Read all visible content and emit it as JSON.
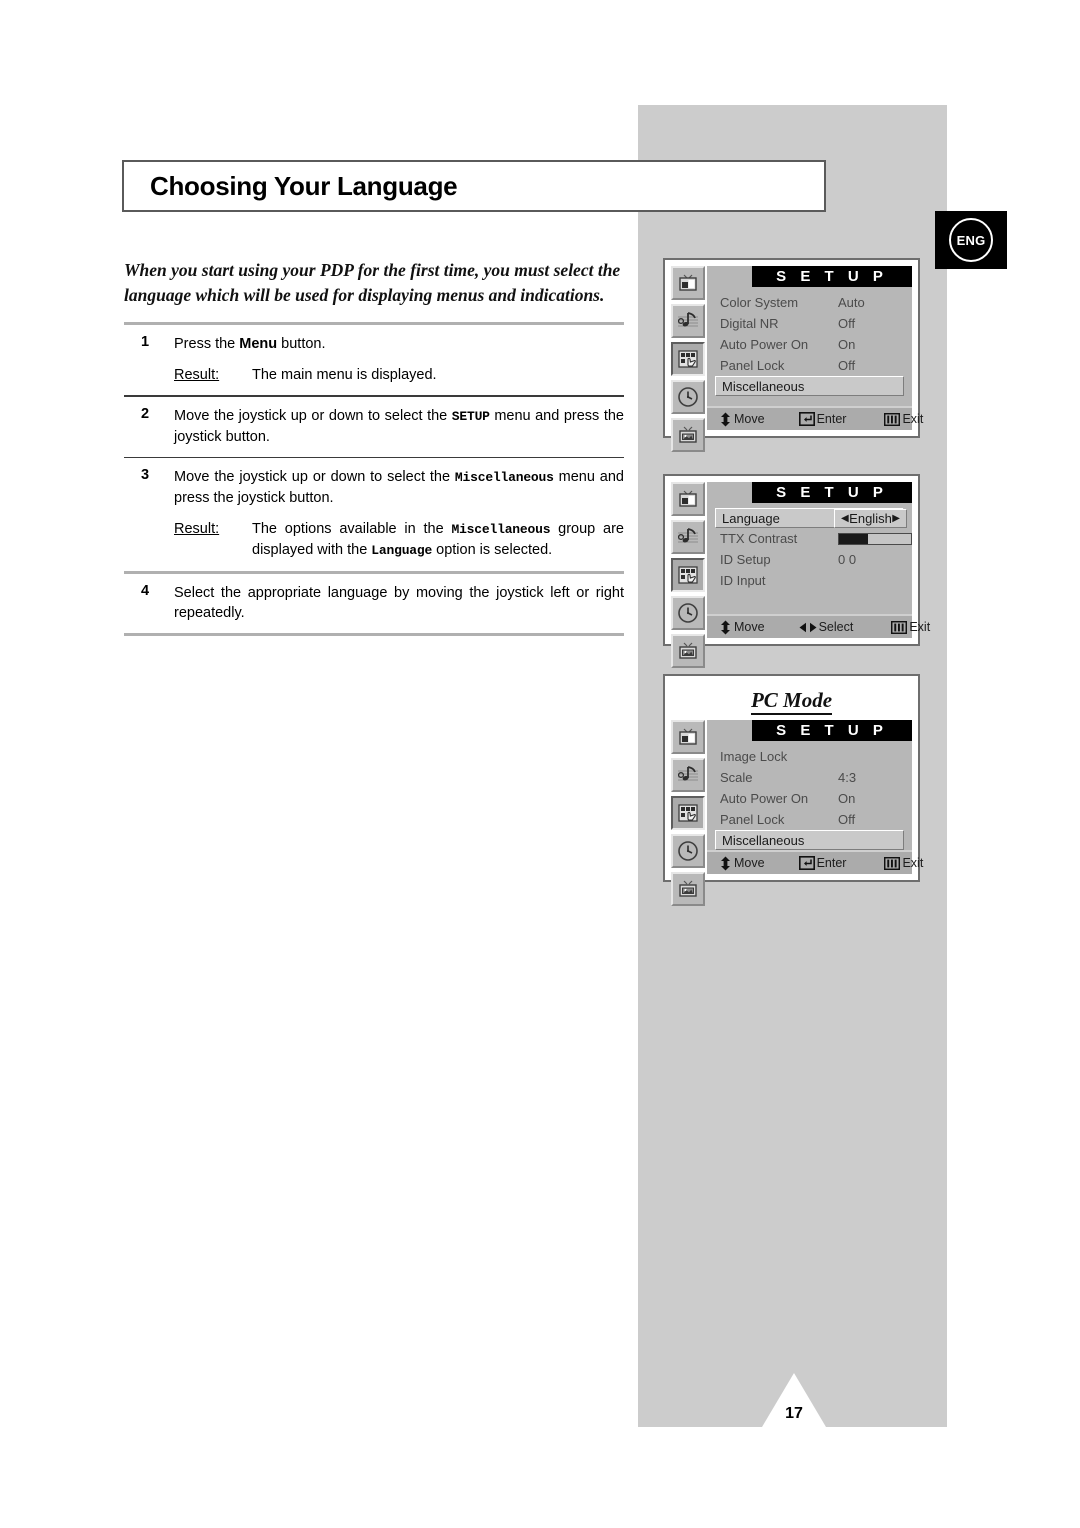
{
  "document": {
    "title": "Choosing Your Language",
    "language_badge": "ENG",
    "page_number": "17",
    "intro": "When you start using your PDP for the first time, you must select the language which will be used for displaying menus and indications."
  },
  "steps": [
    {
      "number": "1",
      "text_parts": [
        {
          "t": "Press the ",
          "style": "normal"
        },
        {
          "t": "Menu",
          "style": "bold"
        },
        {
          "t": " button.",
          "style": "normal"
        }
      ],
      "result_label": "Result:",
      "result_parts": [
        {
          "t": "The main menu is displayed.",
          "style": "normal"
        }
      ]
    },
    {
      "number": "2",
      "text_parts": [
        {
          "t": "Move the joystick up or down to select the ",
          "style": "normal"
        },
        {
          "t": "SETUP",
          "style": "mono"
        },
        {
          "t": " menu and press the joystick button.",
          "style": "normal"
        }
      ],
      "result_label": "",
      "result_parts": []
    },
    {
      "number": "3",
      "text_parts": [
        {
          "t": "Move the joystick up or down to select the ",
          "style": "normal"
        },
        {
          "t": "Miscellaneous",
          "style": "mono"
        },
        {
          "t": " menu and press the joystick button.",
          "style": "normal"
        }
      ],
      "result_label": "Result:",
      "result_parts": [
        {
          "t": "The options available in the ",
          "style": "normal"
        },
        {
          "t": "Miscellaneous",
          "style": "mono"
        },
        {
          "t": " group are displayed with the ",
          "style": "normal"
        },
        {
          "t": "Language",
          "style": "mono"
        },
        {
          "t": " option is selected.",
          "style": "normal"
        }
      ]
    },
    {
      "number": "4",
      "text_parts": [
        {
          "t": "Select the appropriate language by moving the joystick left or right repeatedly.",
          "style": "normal"
        }
      ],
      "result_label": "",
      "result_parts": []
    }
  ],
  "osd_panels": [
    {
      "id": "setup-main",
      "heading": "",
      "title": "S E T U P",
      "rail": [
        "tv-picture-icon",
        "sound-note-icon",
        "setup-hand-icon",
        "clock-icon",
        "pip-screen-icon"
      ],
      "rail_active_index": 2,
      "rows": [
        {
          "label": "Color System",
          "value": "Auto",
          "selected": false,
          "type": "value"
        },
        {
          "label": "Digital NR",
          "value": "Off",
          "selected": false,
          "type": "value"
        },
        {
          "label": "Auto Power On",
          "value": "On",
          "selected": false,
          "type": "value"
        },
        {
          "label": "Panel Lock",
          "value": "Off",
          "selected": false,
          "type": "value"
        },
        {
          "label": "Miscellaneous",
          "value": "",
          "selected": true,
          "type": "value"
        }
      ],
      "footer": [
        {
          "icon": "up-down-arrow-icon",
          "label": "Move"
        },
        {
          "icon": "enter-key-icon",
          "label": "Enter"
        },
        {
          "icon": "menu-bars-icon",
          "label": "Exit"
        }
      ]
    },
    {
      "id": "setup-miscellaneous",
      "heading": "",
      "title": "S E T U P",
      "rail": [
        "tv-picture-icon",
        "sound-note-icon",
        "setup-hand-icon",
        "clock-icon",
        "pip-screen-icon"
      ],
      "rail_active_index": 2,
      "rows": [
        {
          "label": "Language",
          "value": "English",
          "selected": true,
          "type": "picker"
        },
        {
          "label": "TTX Contrast",
          "value": "",
          "selected": false,
          "type": "bar",
          "bar_percent": 40
        },
        {
          "label": "ID Setup",
          "value": "0 0",
          "selected": false,
          "type": "value"
        },
        {
          "label": "ID Input",
          "value": "",
          "selected": false,
          "type": "value"
        }
      ],
      "footer": [
        {
          "icon": "up-down-arrow-icon",
          "label": "Move"
        },
        {
          "icon": "left-right-arrow-icon",
          "label": "Select"
        },
        {
          "icon": "menu-bars-icon",
          "label": "Exit"
        }
      ]
    },
    {
      "id": "setup-pc-mode",
      "heading": "PC Mode",
      "title": "S E T U P",
      "rail": [
        "tv-picture-icon",
        "sound-note-icon",
        "setup-hand-icon",
        "clock-icon",
        "pip-screen-icon"
      ],
      "rail_active_index": 2,
      "rows": [
        {
          "label": "Image Lock",
          "value": "",
          "selected": false,
          "type": "value"
        },
        {
          "label": "Scale",
          "value": "4:3",
          "selected": false,
          "type": "value"
        },
        {
          "label": "Auto Power On",
          "value": "On",
          "selected": false,
          "type": "value"
        },
        {
          "label": "Panel Lock",
          "value": "Off",
          "selected": false,
          "type": "value"
        },
        {
          "label": "Miscellaneous",
          "value": "",
          "selected": true,
          "type": "value"
        }
      ],
      "footer": [
        {
          "icon": "up-down-arrow-icon",
          "label": "Move"
        },
        {
          "icon": "enter-key-icon",
          "label": "Enter"
        },
        {
          "icon": "menu-bars-icon",
          "label": "Exit"
        }
      ]
    }
  ],
  "colors": {
    "panel_grey": "#cccccc",
    "osd_body": "#b7b7b7",
    "osd_title_bg": "#000000",
    "rule": "#b0b0b0"
  }
}
